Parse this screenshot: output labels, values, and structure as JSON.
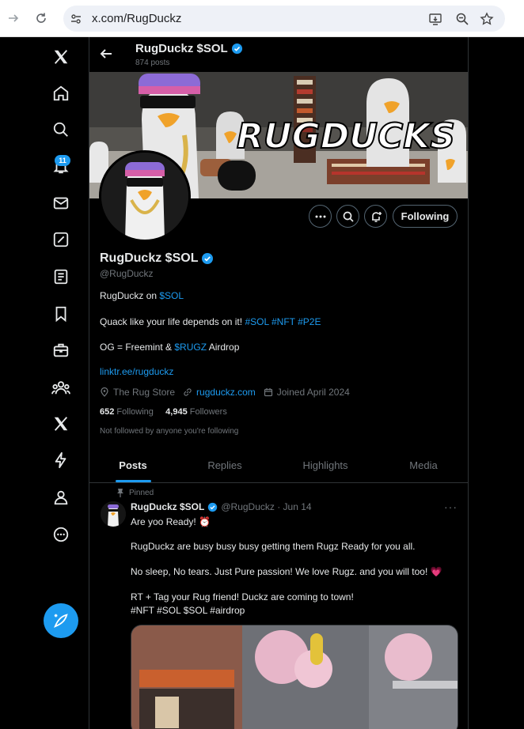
{
  "browser": {
    "url": "x.com/RugDuckz",
    "icons": [
      "forward-icon",
      "reload-icon",
      "site-settings-icon",
      "install-app-icon",
      "zoom-icon",
      "bookmark-star-icon"
    ]
  },
  "nav": {
    "items": [
      "x-logo-icon",
      "home-icon",
      "explore-icon",
      "notifications-icon",
      "messages-icon",
      "grok-icon",
      "lists-icon",
      "bookmarks-icon",
      "jobs-icon",
      "communities-icon",
      "premium-icon",
      "verified-orgs-icon",
      "profile-icon",
      "more-icon"
    ],
    "notifications_badge": "11",
    "post_button_icon": "compose-icon"
  },
  "header": {
    "title": "RugDuckz $SOL",
    "post_count": "874 posts"
  },
  "banner": {
    "text": "RUGDUCKS"
  },
  "profile": {
    "name": "RugDuckz $SOL",
    "handle": "@RugDuckz",
    "follow_label": "Following",
    "bio": {
      "line1_prefix": "RugDuckz on ",
      "line1_tag": "$SOL",
      "line2_prefix": "Quack like your life depends on  it! ",
      "line2_tags": "#SOL #NFT #P2E",
      "line3_prefix": "OG = Freemint & ",
      "line3_tag": "$RUGZ",
      "line3_suffix": " Airdrop",
      "link": "linktr.ee/rugduckz"
    },
    "location": "The Rug Store",
    "website": "rugduckz.com",
    "joined": "Joined April 2024",
    "following_count": "652",
    "following_label": "Following",
    "followers_count": "4,945",
    "followers_label": "Followers",
    "not_followed": "Not followed by anyone you're following"
  },
  "tabs": [
    "Posts",
    "Replies",
    "Highlights",
    "Media"
  ],
  "pinned_tweet": {
    "pinned_label": "Pinned",
    "name": "RugDuckz $SOL",
    "handle_date": "@RugDuckz · Jun 14",
    "line1": "Are yoo Ready! ⏰",
    "line2": "RugDuckz are busy busy busy getting them Rugz Ready for you all.",
    "line3": "No sleep, No tears. Just Pure passion! We love Rugz. and you will too! 💗",
    "line4": "RT + Tag your Rug friend! Duckz are coming to town!",
    "line5": "#NFT #SOL $SOL #airdrop"
  },
  "colors": {
    "accent": "#1d9bf0",
    "background": "#000000",
    "muted": "#71767b",
    "border": "#2f3336"
  }
}
